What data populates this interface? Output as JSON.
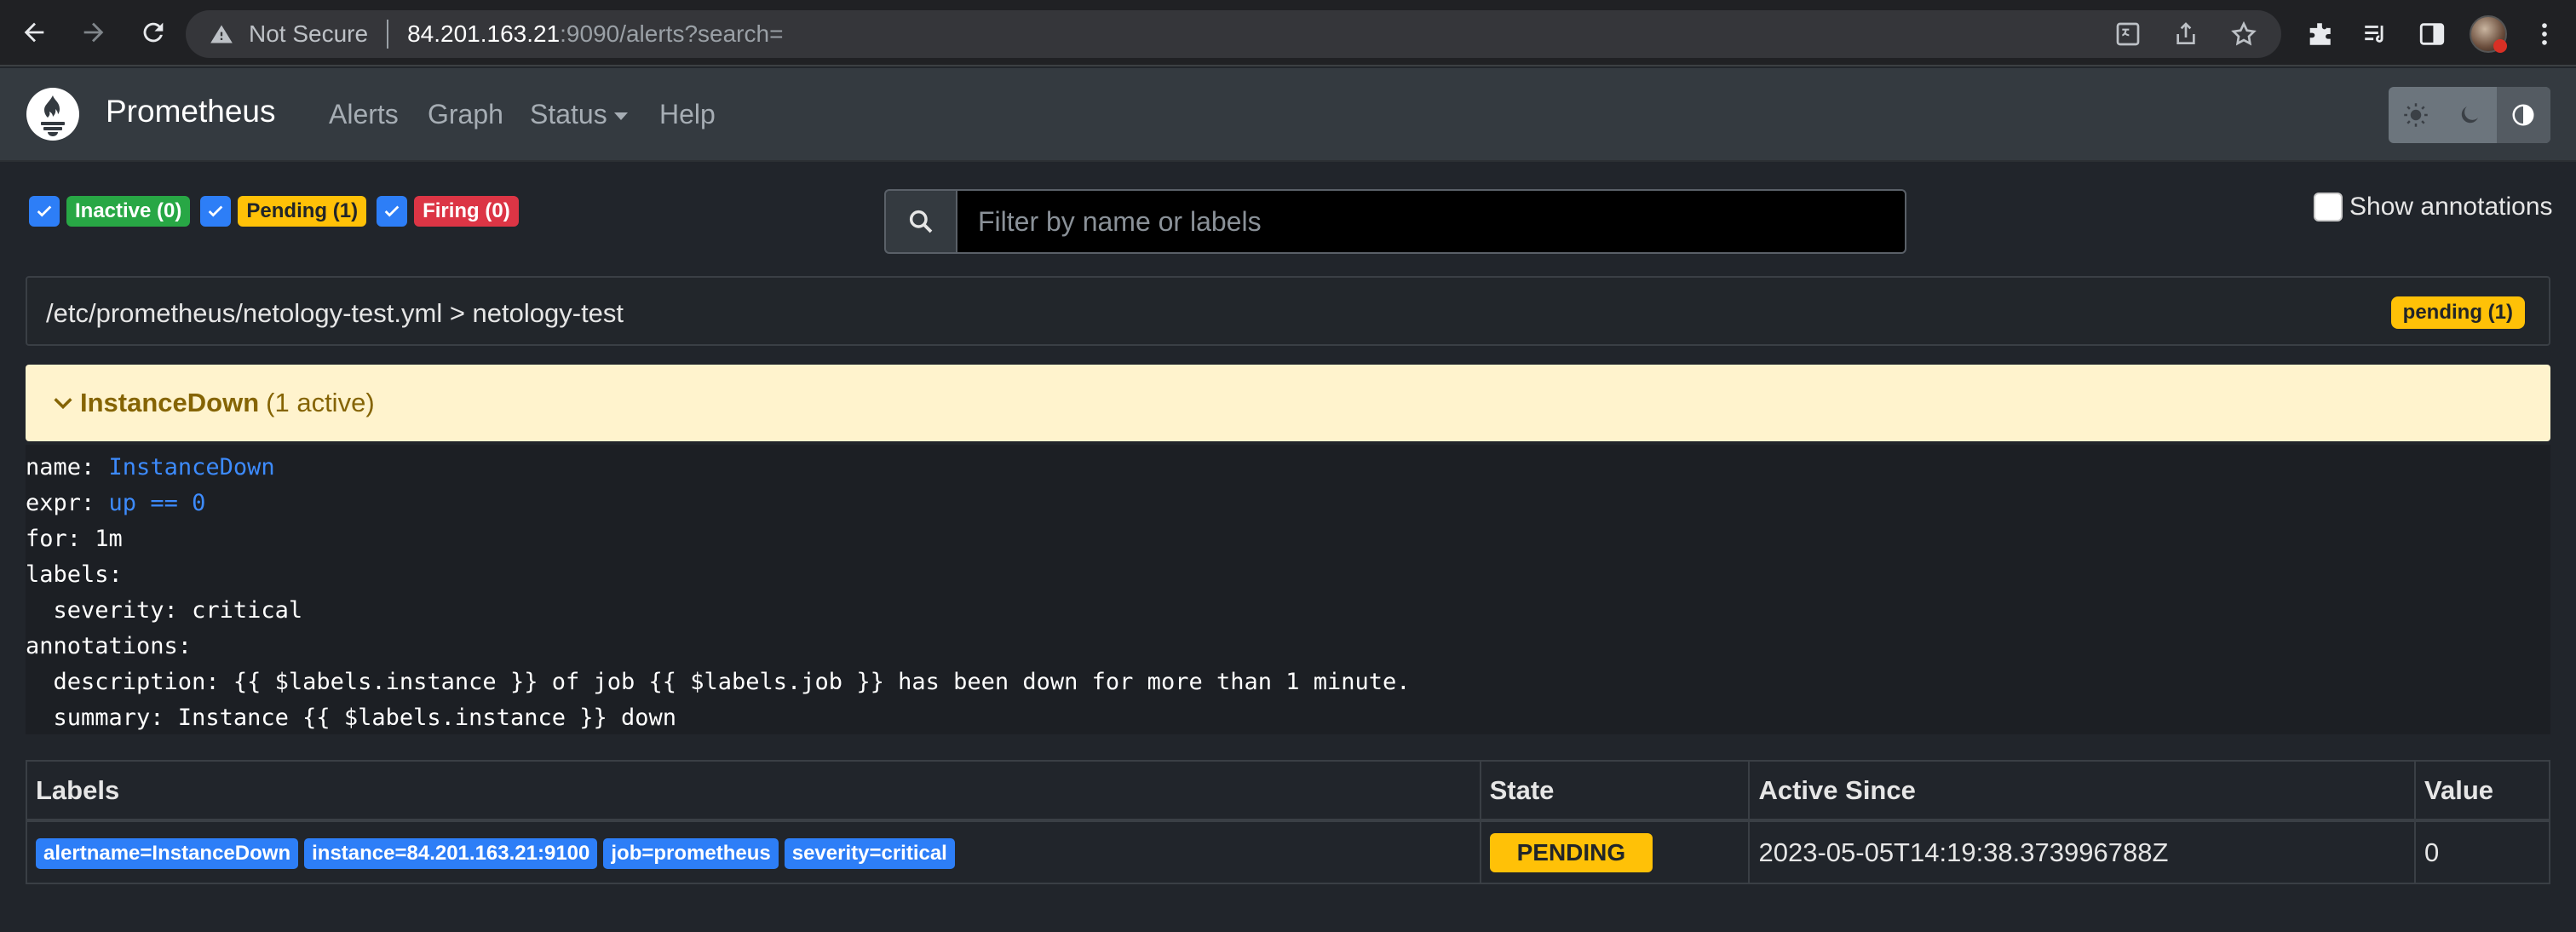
{
  "browser": {
    "security_label": "Not Secure",
    "url_host": "84.201.163.21",
    "url_rest": ":9090/alerts?search="
  },
  "navbar": {
    "brand": "Prometheus",
    "links": [
      "Alerts",
      "Graph",
      "Status",
      "Help"
    ]
  },
  "filters": {
    "inactive": "Inactive (0)",
    "pending": "Pending (1)",
    "firing": "Firing (0)"
  },
  "search": {
    "placeholder": "Filter by name or labels",
    "value": ""
  },
  "show_annotations_label": "Show annotations",
  "group": {
    "title": "/etc/prometheus/netology-test.yml > netology-test",
    "badge": "pending (1)"
  },
  "alert": {
    "name": "InstanceDown",
    "active": "(1 active)"
  },
  "rule": {
    "name_key": "name: ",
    "name_val": "InstanceDown",
    "expr_key": "expr: ",
    "expr_val": "up == 0",
    "for_line": "for: 1m",
    "labels_line": "labels:",
    "severity_line": "  severity: critical",
    "annotations_line": "annotations:",
    "description_line": "  description: {{ $labels.instance }} of job {{ $labels.job }} has been down for more than 1 minute.",
    "summary_line": "  summary: Instance {{ $labels.instance }} down"
  },
  "table": {
    "headers": [
      "Labels",
      "State",
      "Active Since",
      "Value"
    ],
    "rows": [
      {
        "labels": [
          "alertname=InstanceDown",
          "instance=84.201.163.21:9100",
          "job=prometheus",
          "severity=critical"
        ],
        "state": "PENDING",
        "active_since": "2023-05-05T14:19:38.373996788Z",
        "value": "0"
      }
    ]
  },
  "colors": {
    "inactive": "#28a745",
    "pending": "#ffc107",
    "firing": "#dc3545",
    "label": "#2d7ef7"
  }
}
